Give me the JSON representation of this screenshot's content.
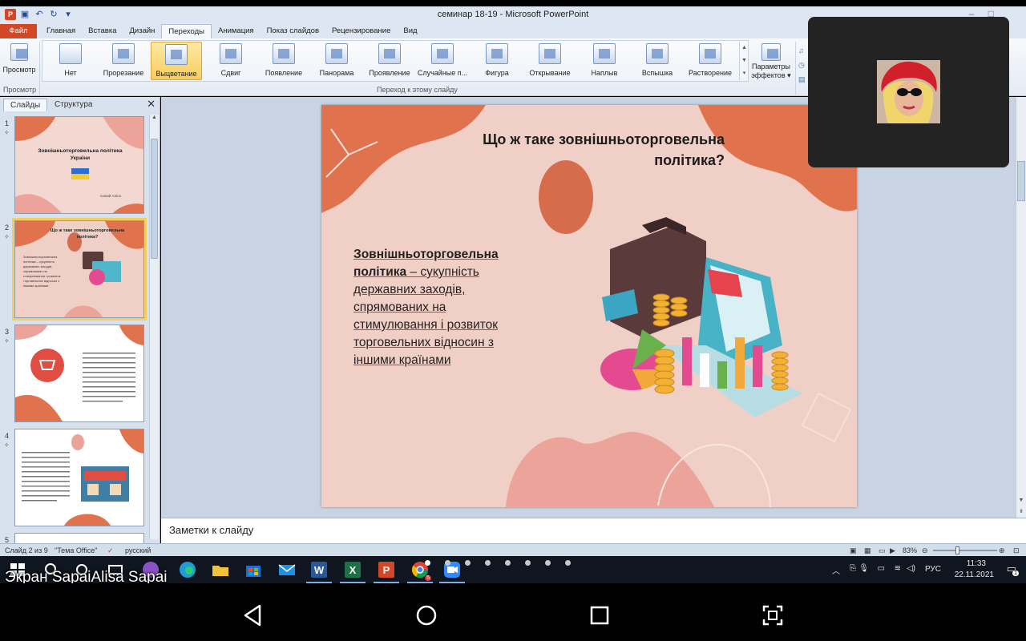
{
  "titlebar": {
    "title": "семинар 18-19  -  Microsoft PowerPoint"
  },
  "tabs": [
    "Файл",
    "Главная",
    "Вставка",
    "Дизайн",
    "Переходы",
    "Анимация",
    "Показ слайдов",
    "Рецензирование",
    "Вид"
  ],
  "ribbon": {
    "preview_label": "Просмотр",
    "preview_group": "Просмотр",
    "transitions": [
      "Нет",
      "Прорезание",
      "Выцветание",
      "Сдвиг",
      "Появление",
      "Панорама",
      "Проявление",
      "Случайные п...",
      "Фигура",
      "Открывание",
      "Наплыв",
      "Вспышка",
      "Растворение"
    ],
    "selected_transition": "Выцветание",
    "group_label": "Переход к этому слайду",
    "effects_label_1": "Параметры",
    "effects_label_2": "эффектов"
  },
  "leftpanel": {
    "tab_slides": "Слайды",
    "tab_outline": "Структура",
    "thumb1_title": "Зовнішньоторговельна політика України",
    "thumb1_author": "Сапай Аліса",
    "thumb2_title": "Що ж таке зовнішньоторговельна політика?"
  },
  "slide": {
    "title": "Що ж таке зовнішньоторговельна політика?",
    "body_bold": "Зовнішньоторговельна політика",
    "body_rest": " – сукупність державних заходів, спрямованих на стимулювання і розвиток торговельних відносин з іншими країнами"
  },
  "notes": {
    "placeholder": "Заметки к слайду"
  },
  "statusbar": {
    "slide_info": "Слайд 2 из 9",
    "theme": "\"Тема Office\"",
    "language": "русский",
    "zoom": "83%"
  },
  "taskbar": {
    "lang": "РУС",
    "time": "11:33",
    "date": "22.11.2021",
    "notif_count": "1",
    "chrome_badge": "5"
  },
  "overlay": {
    "screen_label": "Экран SapaiAlisa Sapai"
  },
  "colors": {
    "accent_file": "#d24726",
    "slide_bg": "#f0cfc7",
    "blob": "#e0734e"
  }
}
